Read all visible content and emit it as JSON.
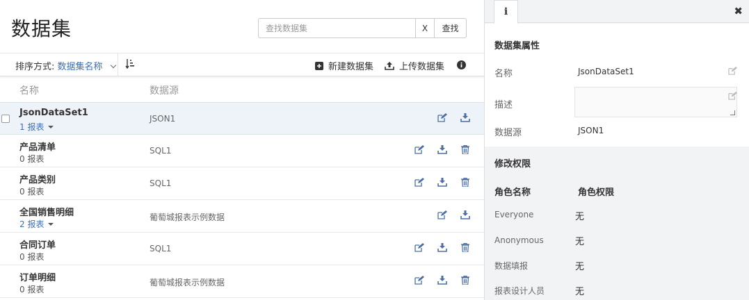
{
  "page_title": "数据集",
  "search": {
    "placeholder": "查找数据集",
    "clear_label": "X",
    "button_label": "查找"
  },
  "toolbar": {
    "sort_label": "排序方式:",
    "sort_value": "数据集名称",
    "new_label": "新建数据集",
    "upload_label": "上传数据集"
  },
  "columns": {
    "name": "名称",
    "source": "数据源"
  },
  "rows": [
    {
      "name": "JsonDataSet1",
      "count": "1 报表",
      "source": "JSON1"
    },
    {
      "name": "产品清单",
      "count": "0 报表",
      "source": "SQL1"
    },
    {
      "name": "产品类别",
      "count": "0 报表",
      "source": "SQL1"
    },
    {
      "name": "全国销售明细",
      "count": "2 报表",
      "source": "葡萄城报表示例数据"
    },
    {
      "name": "合同订单",
      "count": "0 报表",
      "source": "SQL1"
    },
    {
      "name": "订单明细",
      "count": "0 报表",
      "source": "葡萄城报表示例数据"
    }
  ],
  "panel": {
    "info_tab_label": "i",
    "close_label": "✖",
    "props_title": "数据集属性",
    "name_label": "名称",
    "name_value": "JsonDataSet1",
    "desc_label": "描述",
    "source_label": "数据源",
    "source_value": "JSON1",
    "perm_title": "修改权限",
    "role_header": "角色名称",
    "perm_header": "角色权限",
    "roles": [
      {
        "role": "Everyone",
        "perm": "无"
      },
      {
        "role": "Anonymous",
        "perm": "无"
      },
      {
        "role": "数据填报",
        "perm": "无"
      },
      {
        "role": "报表设计人员",
        "perm": "无"
      }
    ]
  },
  "colors": {
    "accent": "#3d6fb0",
    "icon": "#4a6fa5",
    "panel_bg": "#f2f3f5",
    "selected_row": "#eef3fa"
  },
  "icons": [
    "sort-order-icon",
    "plus-square-icon",
    "upload-icon",
    "info-circle-icon",
    "edit-icon",
    "download-icon",
    "trash-icon",
    "close-icon"
  ]
}
